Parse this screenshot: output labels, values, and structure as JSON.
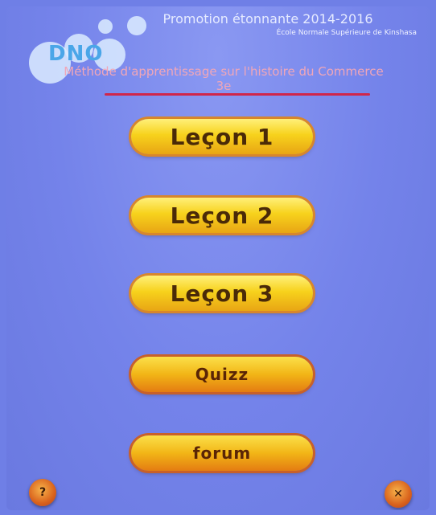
{
  "header": {
    "title": "Promotion étonnante 2014-2016",
    "subtitle": "École Normale Supérieure de Kinshasa",
    "logo_text": "DNO",
    "app_title": "Méthode d'apprentissage sur l'histoire du Commerce 3e"
  },
  "menu": {
    "items": [
      {
        "label": "Leçon 1"
      },
      {
        "label": "Leçon 2"
      },
      {
        "label": "Leçon 3"
      },
      {
        "label": "Quizz"
      },
      {
        "label": "forum"
      }
    ]
  },
  "footer": {
    "left_icon": "help-icon",
    "right_icon": "exit-icon"
  },
  "colors": {
    "background": "#7483ea",
    "button_yellow": "#f7d21c",
    "button_orange": "#e8a514",
    "divider_red": "#d0264a"
  }
}
